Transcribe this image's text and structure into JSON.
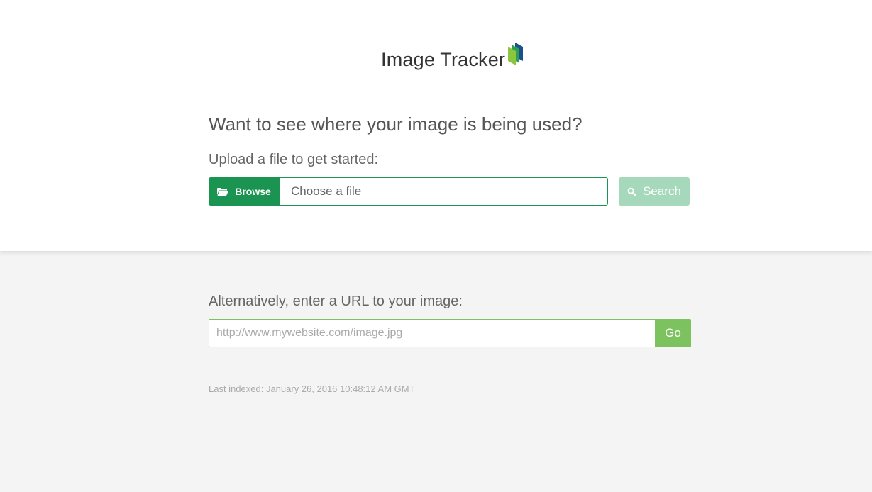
{
  "header": {
    "logo_text": "Image Tracker",
    "logo_icon": "stacked-books-icon"
  },
  "upload": {
    "heading": "Want to see where your image is being used?",
    "label": "Upload a file to get started:",
    "browse_label": "Browse",
    "browse_icon": "folder-open-icon",
    "file_placeholder": "Choose a file",
    "search_label": "Search",
    "search_icon": "search-icon"
  },
  "url": {
    "label": "Alternatively, enter a URL to your image:",
    "placeholder": "http://www.mywebsite.com/image.jpg",
    "value": "",
    "go_label": "Go"
  },
  "footer": {
    "last_indexed": "Last indexed: January 26, 2016 10:48:12 AM GMT"
  },
  "colors": {
    "brand_green": "#1a9450",
    "search_disabled": "#a6d9bc",
    "go_green": "#7cc35f",
    "logo_blue": "#1d4f8f",
    "page_background": "#f4f4f4"
  }
}
